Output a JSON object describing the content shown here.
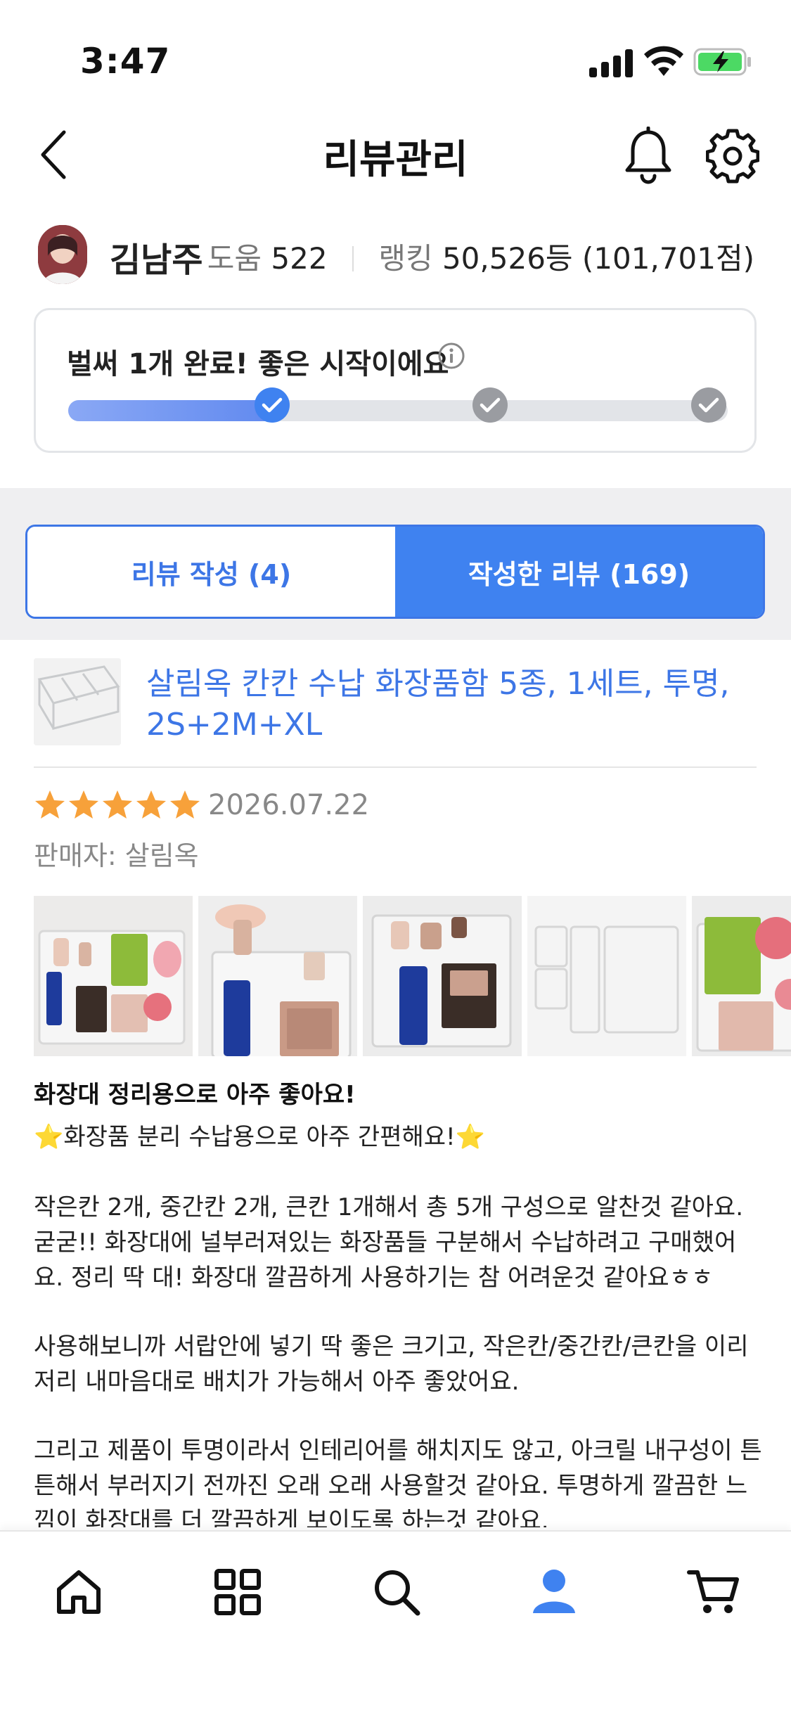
{
  "status_bar": {
    "time": "3:47"
  },
  "header": {
    "title": "리뷰관리"
  },
  "profile": {
    "name": "김남주",
    "help_label": "도움",
    "help_count": "522",
    "ranking_label": "랭킹",
    "ranking_value": "50,526등 (101,701점)"
  },
  "progress": {
    "message": "벌써 1개 완료! 좋은 시작이에요",
    "completed_steps": 1,
    "total_steps": 3,
    "fill_fraction": 0.33
  },
  "tabs": [
    {
      "label": "리뷰 작성 (4)",
      "active": false
    },
    {
      "label": "작성한 리뷰 (169)",
      "active": true
    }
  ],
  "review": {
    "product_title": "살림옥 칸칸 수납 화장품함 5종, 1세트, 투명, 2S+2M+XL",
    "rating": 5,
    "date": "2026.07.22",
    "seller": "판매자: 살림옥",
    "photo_count_visible": 5,
    "headline": "화장대 정리용으로 아주 좋아요!",
    "paragraphs": [
      "⭐화장품 분리 수납용으로 아주 간편해요!⭐",
      "작은칸 2개, 중간칸 2개, 큰칸 1개해서 총 5개 구성으로 알찬것 같아요. 굳굳!! 화장대에 널부러져있는 화장품들 구분해서 수납하려고 구매했어요. 정리 딱 대! 화장대 깔끔하게 사용하기는 참 어려운것 같아요ㅎㅎ",
      "사용해보니까 서랍안에 넣기 딱 좋은 크기고, 작은칸/중간칸/큰칸을 이리저리 내마음대로 배치가 가능해서 아주 좋았어요.",
      "그리고 제품이 투명이라서 인테리어를 해치지도 않고, 아크릴 내구성이 튼튼해서 부러지기 전까진 오래 오래 사용할것 같아요. 투명하게 깔끔한 느낌이 화장대를 더 깔끔하게 보이도록 하는것 같아요."
    ]
  },
  "bottom_nav": [
    {
      "icon": "home-icon",
      "active": false
    },
    {
      "icon": "categories-icon",
      "active": false
    },
    {
      "icon": "search-icon",
      "active": false
    },
    {
      "icon": "person-icon",
      "active": true
    },
    {
      "icon": "cart-icon",
      "active": false
    }
  ],
  "colors": {
    "accent": "#3F82F0",
    "accent_text": "#3D76E6",
    "star": "#F7A13A",
    "progress_gradient_start": "#8AA8F5",
    "step_inactive": "#9A9CA1"
  }
}
